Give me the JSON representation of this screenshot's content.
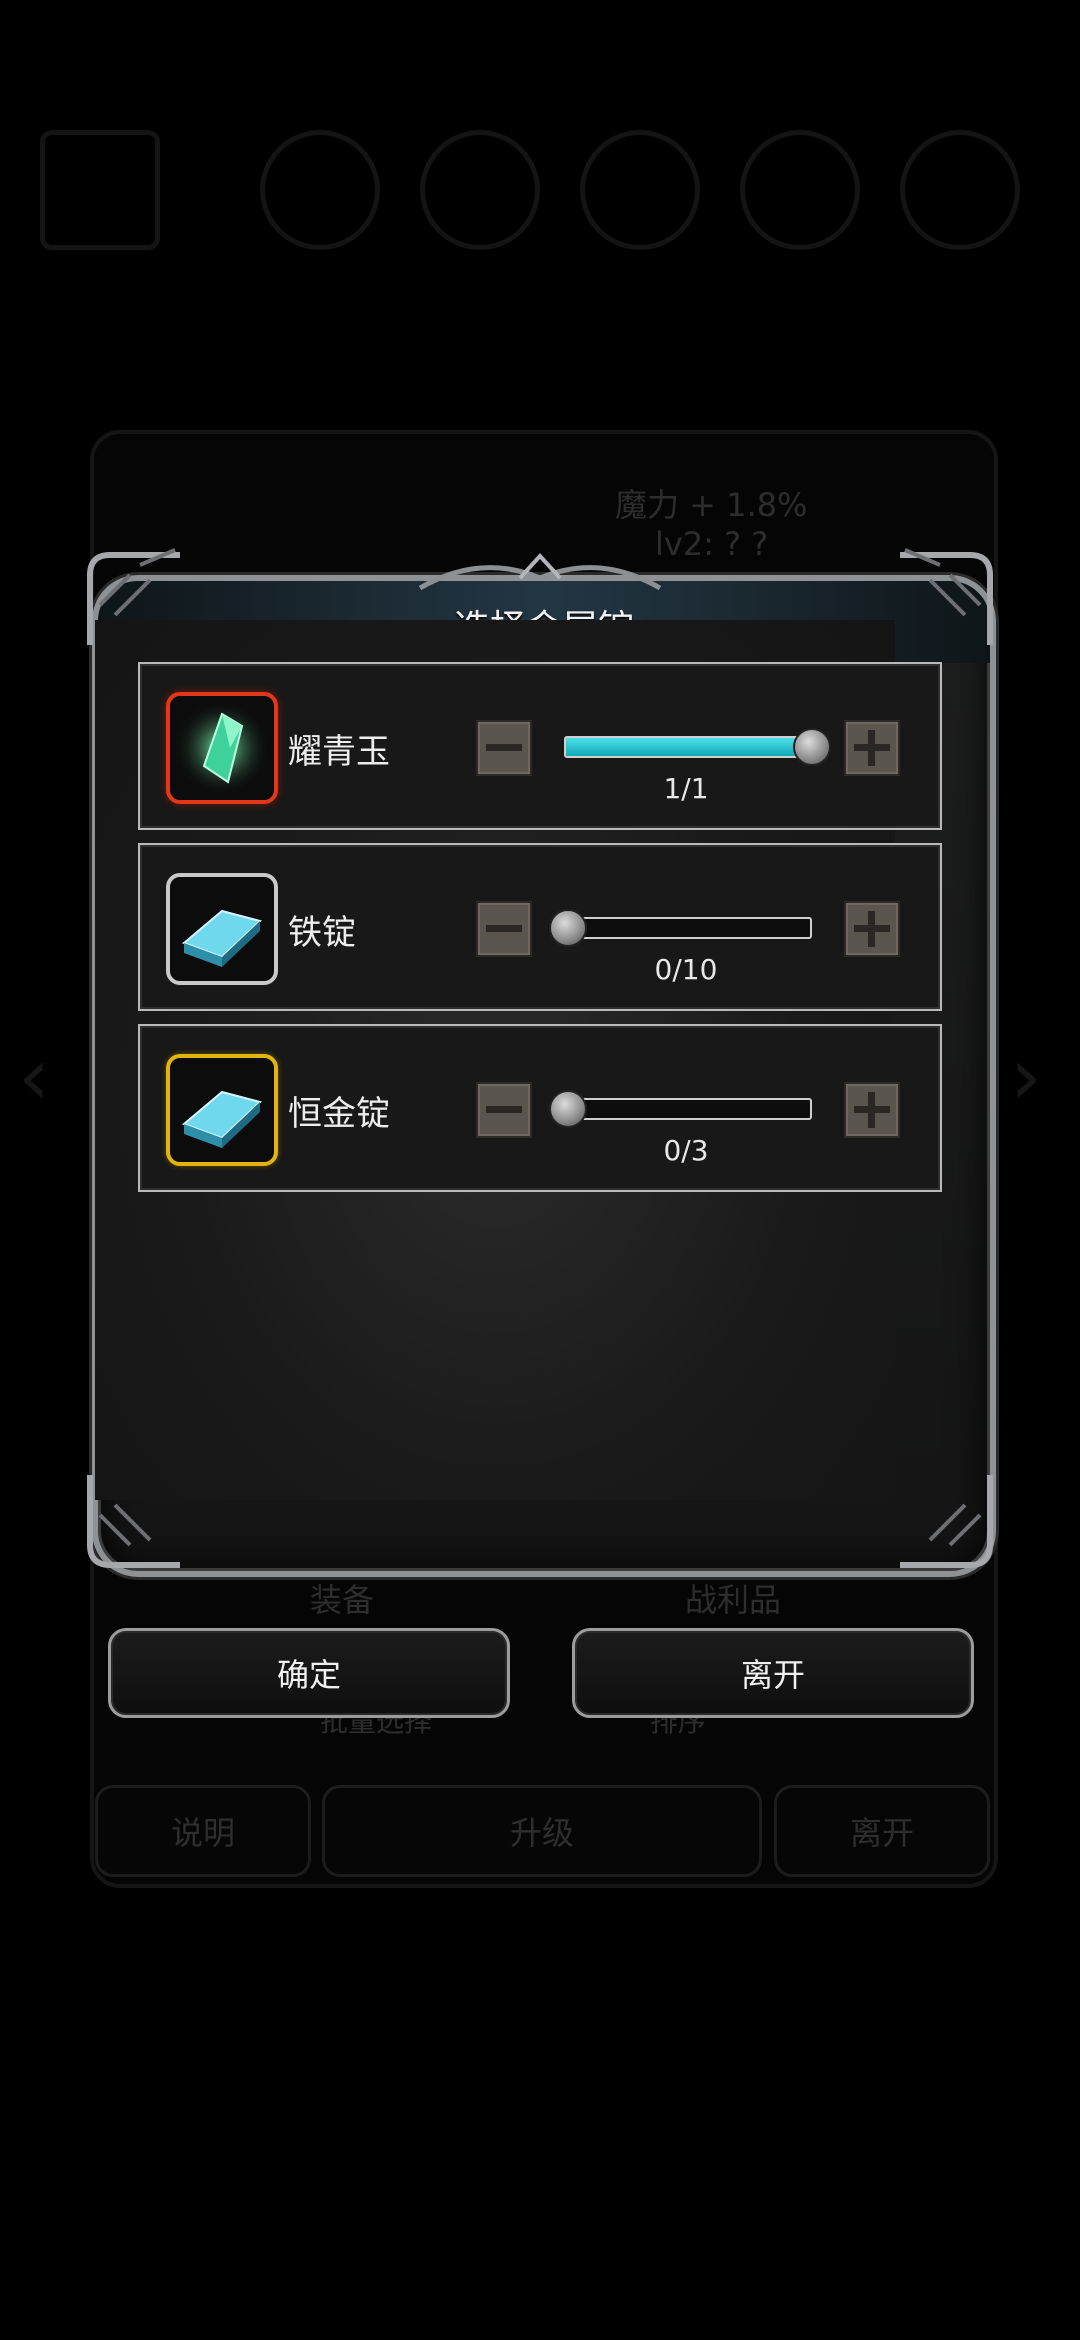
{
  "background": {
    "stat_text": "魔力 + 1.8%",
    "stat_sub": "lv2: ? ?",
    "tab_equipment": "装备",
    "tab_loot": "战利品",
    "sub_batch": "批量选择",
    "sub_sort": "排序",
    "btn_help": "说明",
    "btn_upgrade": "升级",
    "btn_leave": "离开"
  },
  "dialog": {
    "title": "选择金属锭",
    "items": [
      {
        "name": "耀青玉",
        "icon": "jade-crystal-icon",
        "rarity_color": "#e2381a",
        "current": 1,
        "max": 1,
        "count_label": "1/1"
      },
      {
        "name": "铁锭",
        "icon": "iron-ingot-icon",
        "rarity_color": "#c9c9c9",
        "current": 0,
        "max": 10,
        "count_label": "0/10"
      },
      {
        "name": "恒金锭",
        "icon": "eternal-gold-ingot-icon",
        "rarity_color": "#e2b410",
        "current": 0,
        "max": 3,
        "count_label": "0/3"
      }
    ],
    "confirm_label": "确定",
    "leave_label": "离开"
  },
  "colors": {
    "slider_fill": "#2fc7d4",
    "border": "#8f9295"
  }
}
